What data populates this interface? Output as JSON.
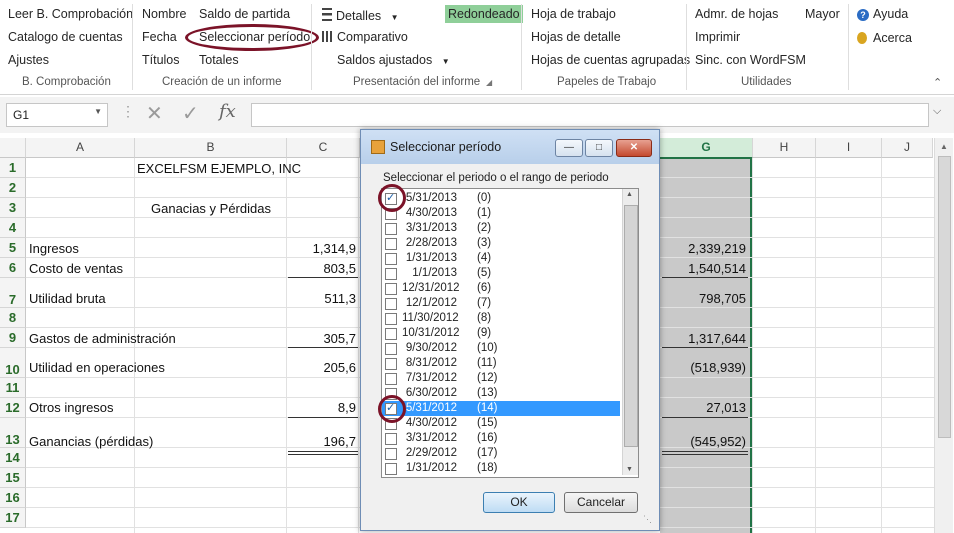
{
  "ribbon": {
    "groups": [
      {
        "label": "B. Comprobación",
        "items": [
          "Leer B. Comprobación",
          "Catalogo de cuentas",
          "Ajustes"
        ]
      },
      {
        "label": "Creación de un informe",
        "items": [
          "Nombre",
          "Fecha",
          "Títulos",
          "Saldo de partida",
          "Seleccionar período",
          "Totales"
        ]
      },
      {
        "label": "Presentación del informe",
        "items": [
          "Detalles",
          "Comparativo",
          "Saldos ajustados",
          "Redondeado"
        ]
      },
      {
        "label": "Papeles de Trabajo",
        "items": [
          "Hoja de trabajo",
          "Hojas de detalle",
          "Hojas de cuentas agrupadas"
        ]
      },
      {
        "label": "Utilidades",
        "items": [
          "Admr. de hojas",
          "Imprimir",
          "Sinc. con WordFSM",
          "Mayor"
        ]
      },
      {
        "label": "",
        "items": [
          "Ayuda",
          "Acerca"
        ]
      }
    ]
  },
  "formula_bar": {
    "name_box": "G1",
    "value": ""
  },
  "sheet": {
    "columns": [
      "A",
      "B",
      "C",
      "G",
      "H",
      "I",
      "J"
    ],
    "rows": [
      "1",
      "2",
      "3",
      "4",
      "5",
      "6",
      "7",
      "8",
      "9",
      "10",
      "11",
      "12",
      "13",
      "14",
      "15",
      "16",
      "17"
    ],
    "title": "EXCELFSM EJEMPLO, INC",
    "subtitle": "Ganacias y Pérdidas",
    "lines": [
      {
        "label": "Ingresos",
        "c": "1,314,9",
        "g": "2,339,219"
      },
      {
        "label": "Costo de ventas",
        "c": "803,5",
        "g": "1,540,514"
      },
      {
        "label": "Utilidad bruta",
        "c": "511,3",
        "g": "798,705"
      },
      {
        "label": "Gastos de administración",
        "c": "305,7",
        "g": "1,317,644"
      },
      {
        "label": "Utilidad en operaciones",
        "c": "205,6",
        "g": "(518,939)"
      },
      {
        "label": "Otros ingresos",
        "c": "8,9",
        "g": "27,013"
      },
      {
        "label": "Ganancias (pérdidas)",
        "c": "196,7",
        "g": "(545,952)"
      }
    ]
  },
  "dialog": {
    "title": "Seleccionar período",
    "instruction": "Seleccionar el periodo o el rango de periodo",
    "items": [
      {
        "date": "5/31/2013",
        "idx": "(0)",
        "checked": true
      },
      {
        "date": "4/30/2013",
        "idx": "(1)",
        "checked": false
      },
      {
        "date": "3/31/2013",
        "idx": "(2)",
        "checked": false
      },
      {
        "date": "2/28/2013",
        "idx": "(3)",
        "checked": false
      },
      {
        "date": "1/31/2013",
        "idx": "(4)",
        "checked": false
      },
      {
        "date": "1/1/2013",
        "idx": "(5)",
        "checked": false
      },
      {
        "date": "12/31/2012",
        "idx": "(6)",
        "checked": false
      },
      {
        "date": "12/1/2012",
        "idx": "(7)",
        "checked": false
      },
      {
        "date": "11/30/2012",
        "idx": "(8)",
        "checked": false
      },
      {
        "date": "10/31/2012",
        "idx": "(9)",
        "checked": false
      },
      {
        "date": "9/30/2012",
        "idx": "(10)",
        "checked": false
      },
      {
        "date": "8/31/2012",
        "idx": "(11)",
        "checked": false
      },
      {
        "date": "7/31/2012",
        "idx": "(12)",
        "checked": false
      },
      {
        "date": "6/30/2012",
        "idx": "(13)",
        "checked": false
      },
      {
        "date": "5/31/2012",
        "idx": "(14)",
        "checked": true,
        "selected": true
      },
      {
        "date": "4/30/2012",
        "idx": "(15)",
        "checked": false
      },
      {
        "date": "3/31/2012",
        "idx": "(16)",
        "checked": false
      },
      {
        "date": "2/29/2012",
        "idx": "(17)",
        "checked": false
      },
      {
        "date": "1/31/2012",
        "idx": "(18)",
        "checked": false
      }
    ],
    "ok": "OK",
    "cancel": "Cancelar"
  },
  "colors": {
    "highlight": "#8fcf99",
    "annotation_ring": "#7b1328",
    "selection": "#3399ff",
    "active_col": "#2a6b2a"
  }
}
